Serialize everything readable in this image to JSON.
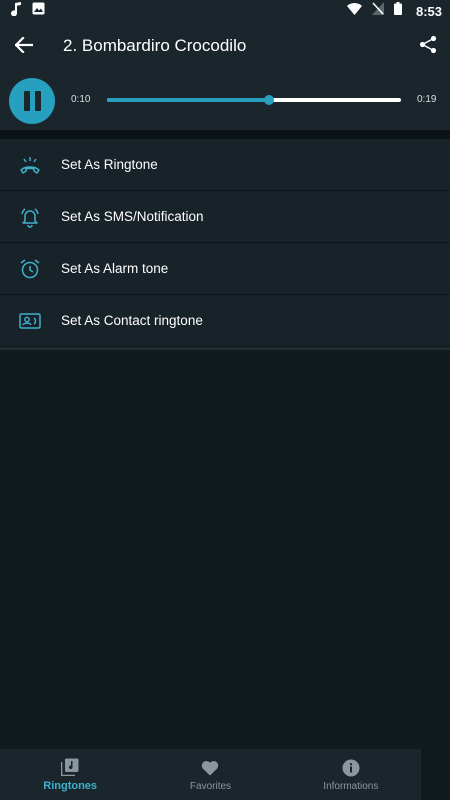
{
  "status_bar": {
    "time": "8:53",
    "icons_left": [
      "music-note-icon",
      "image-icon"
    ],
    "icons_right": [
      "wifi-icon",
      "no-signal-icon",
      "battery-icon"
    ]
  },
  "app_bar": {
    "title": "2. Bombardiro Crocodilo",
    "back_icon": "arrow-back-icon",
    "share_icon": "share-icon"
  },
  "player": {
    "state_icon": "pause-icon",
    "current_time": "0:10",
    "total_time": "0:19",
    "progress_fraction": 0.55
  },
  "actions": [
    {
      "icon": "ringtone-phone-icon",
      "label": "Set As Ringtone"
    },
    {
      "icon": "notification-bell-icon",
      "label": "Set As SMS/Notification"
    },
    {
      "icon": "alarm-clock-icon",
      "label": "Set As Alarm tone"
    },
    {
      "icon": "contact-card-icon",
      "label": "Set As Contact ringtone"
    }
  ],
  "bottom_nav": {
    "active": "Ringtones",
    "items": [
      {
        "icon": "music-library-icon",
        "label": "Ringtones"
      },
      {
        "icon": "heart-icon",
        "label": "Favorites"
      },
      {
        "icon": "info-icon",
        "label": "Informations"
      }
    ]
  },
  "colors": {
    "accent": "#27a0bf",
    "bar_background": "#1a262c",
    "list_background": "#182329",
    "page_background": "#111a1f"
  }
}
